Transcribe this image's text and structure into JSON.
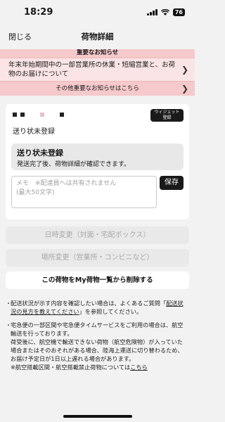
{
  "status_bar": {
    "time": "18:29",
    "battery": "76"
  },
  "nav": {
    "close": "閉じる",
    "title": "荷物詳細"
  },
  "notice": {
    "header": "重要なお知らせ",
    "main": "年末年始期間中の一部営業所の休業・短縮営業と、お荷物のお届けについて",
    "other": "その他重要なお知らせはこちら"
  },
  "card": {
    "widget_line1": "ウィジェット",
    "widget_line2": "登録",
    "status_title": "送り状未登録",
    "status_box_title": "送り状未登録",
    "status_box_desc": "発送完了後、荷物詳細が確認できます。",
    "memo_placeholder": "メモ　※配達員へは共有されません\n(最大50文字)",
    "save": "保存"
  },
  "actions": {
    "date_change": "日時変更（対面・宅配ボックス）",
    "place_change": "場所変更（営業所・コンビニなど）",
    "delete": "この荷物をMy荷物一覧から削除する"
  },
  "notes": {
    "n1_a": "配送状況が示す内容を確認したい場合は、よくあるご質問「",
    "n1_link": "配送状況の見方を教えてください",
    "n1_b": "」を参照してください。",
    "n2_a": "宅急便の一部区間や宅急便タイムサービスをご利用の場合は、航空輸送を行っております。",
    "n2_b": "荷受後に、航空機で輸送できない荷物（航空危険物）が入っていた場合またはそのおそれがある場合、陸海上運送に切り替わるため、お届け予定日が1日以上遅れる場合があります。",
    "n2_c": "※航空搭載区間・航空搭載禁止荷物については",
    "n2_link": "こちら"
  }
}
